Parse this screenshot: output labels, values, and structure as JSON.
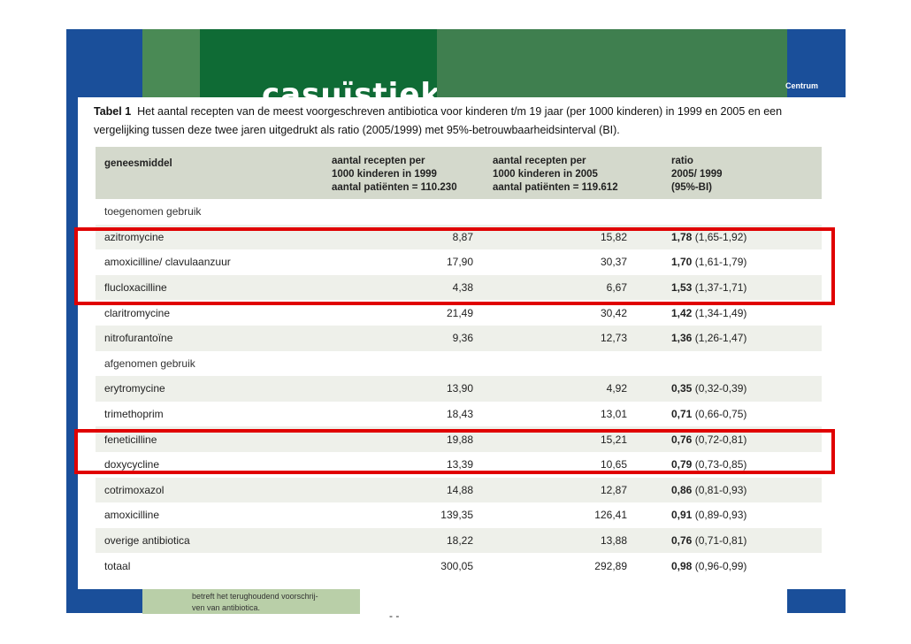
{
  "background": {
    "header_word": "casuïstiek",
    "centrum_label": "Centrum",
    "note_lines": [
      "betreft het terughoudend voorschrij-",
      "ven van antibiotica."
    ],
    "fragment": "- -"
  },
  "caption": {
    "label": "Tabel 1",
    "text": "Het aantal recepten van de meest voorgeschreven antibiotica voor kinderen t/m 19 jaar (per 1000 kinderen) in 1999 en 2005 en een vergelijking tussen deze twee jaren uitgedrukt als ratio (2005/1999) met 95%-betrouwbaarheidsinterval (BI)."
  },
  "table": {
    "headers": {
      "col1": "geneesmiddel",
      "col2": [
        "aantal recepten per",
        "1000 kinderen in 1999",
        "aantal patiënten = 110.230"
      ],
      "col3": [
        "aantal recepten per",
        "1000 kinderen in 2005",
        "aantal patiënten = 119.612"
      ],
      "col4": [
        "ratio",
        "2005/ 1999",
        "(95%-BI)"
      ]
    },
    "sections": {
      "increased": "toegenomen gebruik",
      "decreased": "afgenomen gebruik"
    },
    "rows": [
      {
        "name": "azitromycine",
        "v1999": "8,87",
        "v2005": "15,82",
        "ratio": "1,78",
        "ci": "(1,65-1,92)"
      },
      {
        "name": "amoxicilline/ clavulaanzuur",
        "v1999": "17,90",
        "v2005": "30,37",
        "ratio": "1,70",
        "ci": "(1,61-1,79)"
      },
      {
        "name": "flucloxacilline",
        "v1999": "4,38",
        "v2005": "6,67",
        "ratio": "1,53",
        "ci": "(1,37-1,71)"
      },
      {
        "name": "claritromycine",
        "v1999": "21,49",
        "v2005": "30,42",
        "ratio": "1,42",
        "ci": "(1,34-1,49)"
      },
      {
        "name": "nitrofurantoïne",
        "v1999": "9,36",
        "v2005": "12,73",
        "ratio": "1,36",
        "ci": "(1,26-1,47)"
      },
      {
        "name": "erytromycine",
        "v1999": "13,90",
        "v2005": "4,92",
        "ratio": "0,35",
        "ci": "(0,32-0,39)"
      },
      {
        "name": "trimethoprim",
        "v1999": "18,43",
        "v2005": "13,01",
        "ratio": "0,71",
        "ci": "(0,66-0,75)"
      },
      {
        "name": "feneticilline",
        "v1999": "19,88",
        "v2005": "15,21",
        "ratio": "0,76",
        "ci": "(0,72-0,81)"
      },
      {
        "name": "doxycycline",
        "v1999": "13,39",
        "v2005": "10,65",
        "ratio": "0,79",
        "ci": "(0,73-0,85)"
      },
      {
        "name": "cotrimoxazol",
        "v1999": "14,88",
        "v2005": "12,87",
        "ratio": "0,86",
        "ci": "(0,81-0,93)"
      },
      {
        "name": "amoxicilline",
        "v1999": "139,35",
        "v2005": "126,41",
        "ratio": "0,91",
        "ci": "(0,89-0,93)"
      },
      {
        "name": "overige antibiotica",
        "v1999": "18,22",
        "v2005": "13,88",
        "ratio": "0,76",
        "ci": "(0,71-0,81)"
      },
      {
        "name": "totaal",
        "v1999": "300,05",
        "v2005": "292,89",
        "ratio": "0,98",
        "ci": "(0,96-0,99)"
      }
    ]
  },
  "colors": {
    "highlight": "#e00000",
    "header_bg": "#d4d9cc",
    "shade_bg": "#eef0ea"
  }
}
